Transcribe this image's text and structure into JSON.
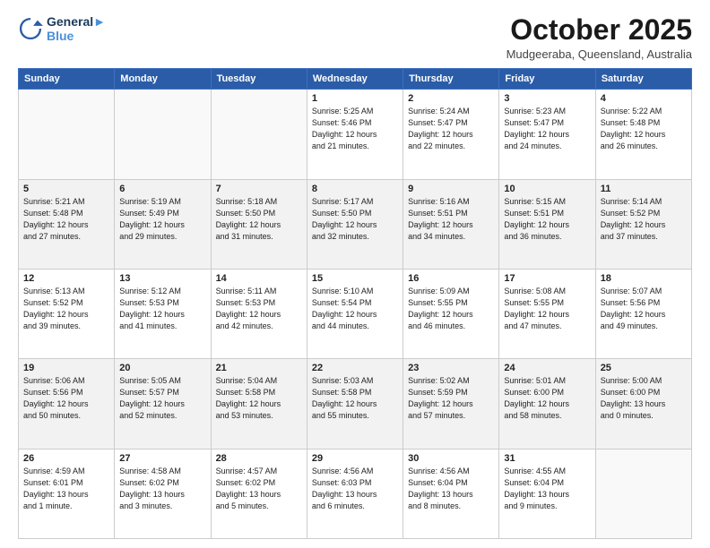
{
  "logo": {
    "line1": "General",
    "line2": "Blue"
  },
  "title": "October 2025",
  "location": "Mudgeeraba, Queensland, Australia",
  "weekdays": [
    "Sunday",
    "Monday",
    "Tuesday",
    "Wednesday",
    "Thursday",
    "Friday",
    "Saturday"
  ],
  "weeks": [
    [
      {
        "day": "",
        "info": ""
      },
      {
        "day": "",
        "info": ""
      },
      {
        "day": "",
        "info": ""
      },
      {
        "day": "1",
        "info": "Sunrise: 5:25 AM\nSunset: 5:46 PM\nDaylight: 12 hours\nand 21 minutes."
      },
      {
        "day": "2",
        "info": "Sunrise: 5:24 AM\nSunset: 5:47 PM\nDaylight: 12 hours\nand 22 minutes."
      },
      {
        "day": "3",
        "info": "Sunrise: 5:23 AM\nSunset: 5:47 PM\nDaylight: 12 hours\nand 24 minutes."
      },
      {
        "day": "4",
        "info": "Sunrise: 5:22 AM\nSunset: 5:48 PM\nDaylight: 12 hours\nand 26 minutes."
      }
    ],
    [
      {
        "day": "5",
        "info": "Sunrise: 5:21 AM\nSunset: 5:48 PM\nDaylight: 12 hours\nand 27 minutes."
      },
      {
        "day": "6",
        "info": "Sunrise: 5:19 AM\nSunset: 5:49 PM\nDaylight: 12 hours\nand 29 minutes."
      },
      {
        "day": "7",
        "info": "Sunrise: 5:18 AM\nSunset: 5:50 PM\nDaylight: 12 hours\nand 31 minutes."
      },
      {
        "day": "8",
        "info": "Sunrise: 5:17 AM\nSunset: 5:50 PM\nDaylight: 12 hours\nand 32 minutes."
      },
      {
        "day": "9",
        "info": "Sunrise: 5:16 AM\nSunset: 5:51 PM\nDaylight: 12 hours\nand 34 minutes."
      },
      {
        "day": "10",
        "info": "Sunrise: 5:15 AM\nSunset: 5:51 PM\nDaylight: 12 hours\nand 36 minutes."
      },
      {
        "day": "11",
        "info": "Sunrise: 5:14 AM\nSunset: 5:52 PM\nDaylight: 12 hours\nand 37 minutes."
      }
    ],
    [
      {
        "day": "12",
        "info": "Sunrise: 5:13 AM\nSunset: 5:52 PM\nDaylight: 12 hours\nand 39 minutes."
      },
      {
        "day": "13",
        "info": "Sunrise: 5:12 AM\nSunset: 5:53 PM\nDaylight: 12 hours\nand 41 minutes."
      },
      {
        "day": "14",
        "info": "Sunrise: 5:11 AM\nSunset: 5:53 PM\nDaylight: 12 hours\nand 42 minutes."
      },
      {
        "day": "15",
        "info": "Sunrise: 5:10 AM\nSunset: 5:54 PM\nDaylight: 12 hours\nand 44 minutes."
      },
      {
        "day": "16",
        "info": "Sunrise: 5:09 AM\nSunset: 5:55 PM\nDaylight: 12 hours\nand 46 minutes."
      },
      {
        "day": "17",
        "info": "Sunrise: 5:08 AM\nSunset: 5:55 PM\nDaylight: 12 hours\nand 47 minutes."
      },
      {
        "day": "18",
        "info": "Sunrise: 5:07 AM\nSunset: 5:56 PM\nDaylight: 12 hours\nand 49 minutes."
      }
    ],
    [
      {
        "day": "19",
        "info": "Sunrise: 5:06 AM\nSunset: 5:56 PM\nDaylight: 12 hours\nand 50 minutes."
      },
      {
        "day": "20",
        "info": "Sunrise: 5:05 AM\nSunset: 5:57 PM\nDaylight: 12 hours\nand 52 minutes."
      },
      {
        "day": "21",
        "info": "Sunrise: 5:04 AM\nSunset: 5:58 PM\nDaylight: 12 hours\nand 53 minutes."
      },
      {
        "day": "22",
        "info": "Sunrise: 5:03 AM\nSunset: 5:58 PM\nDaylight: 12 hours\nand 55 minutes."
      },
      {
        "day": "23",
        "info": "Sunrise: 5:02 AM\nSunset: 5:59 PM\nDaylight: 12 hours\nand 57 minutes."
      },
      {
        "day": "24",
        "info": "Sunrise: 5:01 AM\nSunset: 6:00 PM\nDaylight: 12 hours\nand 58 minutes."
      },
      {
        "day": "25",
        "info": "Sunrise: 5:00 AM\nSunset: 6:00 PM\nDaylight: 13 hours\nand 0 minutes."
      }
    ],
    [
      {
        "day": "26",
        "info": "Sunrise: 4:59 AM\nSunset: 6:01 PM\nDaylight: 13 hours\nand 1 minute."
      },
      {
        "day": "27",
        "info": "Sunrise: 4:58 AM\nSunset: 6:02 PM\nDaylight: 13 hours\nand 3 minutes."
      },
      {
        "day": "28",
        "info": "Sunrise: 4:57 AM\nSunset: 6:02 PM\nDaylight: 13 hours\nand 5 minutes."
      },
      {
        "day": "29",
        "info": "Sunrise: 4:56 AM\nSunset: 6:03 PM\nDaylight: 13 hours\nand 6 minutes."
      },
      {
        "day": "30",
        "info": "Sunrise: 4:56 AM\nSunset: 6:04 PM\nDaylight: 13 hours\nand 8 minutes."
      },
      {
        "day": "31",
        "info": "Sunrise: 4:55 AM\nSunset: 6:04 PM\nDaylight: 13 hours\nand 9 minutes."
      },
      {
        "day": "",
        "info": ""
      }
    ]
  ]
}
